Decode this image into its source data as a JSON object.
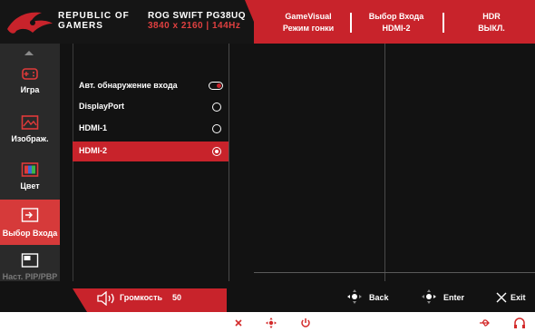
{
  "header": {
    "brand_line1": "REPUBLIC OF",
    "brand_line2": "GAMERS",
    "model": "ROG SWIFT PG38UQ",
    "resolution": "3840 x 2160 | 144Hz",
    "status": [
      {
        "title": "GameVisual",
        "value": "Режим гонки"
      },
      {
        "title": "Выбор Входа",
        "value": "HDMI-2"
      },
      {
        "title": "HDR",
        "value": "ВЫКЛ."
      }
    ]
  },
  "sidebar": {
    "items": [
      {
        "label": "Игра",
        "icon": "gamepad-icon"
      },
      {
        "label": "Изображ.",
        "icon": "image-icon"
      },
      {
        "label": "Цвет",
        "icon": "color-icon"
      },
      {
        "label": "Выбор Входа",
        "icon": "input-select-icon"
      },
      {
        "label": "Наст. PIP/PBP",
        "icon": "pip-pbp-icon"
      }
    ]
  },
  "menu": {
    "options": [
      {
        "label": "Авт. обнаружение входа",
        "control": "toggle"
      },
      {
        "label": "DisplayPort",
        "control": "radio"
      },
      {
        "label": "HDMI-1",
        "control": "radio"
      },
      {
        "label": "HDMI-2",
        "control": "radio",
        "selected": true
      }
    ]
  },
  "footer": {
    "volume_label": "Громкость",
    "volume_value": "50",
    "back_label": "Back",
    "enter_label": "Enter",
    "exit_label": "Exit"
  },
  "colors": {
    "accent_red": "#c8232b",
    "active_nav": "#d63a3a",
    "background": "#121212"
  }
}
